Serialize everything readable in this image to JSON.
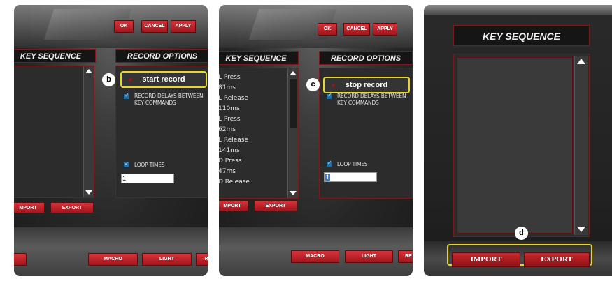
{
  "panel_b": {
    "buttons": {
      "ok": "OK",
      "cancel": "CANCEL",
      "apply": "APPLY"
    },
    "key_sequence_title": "KEY SEQUENCE",
    "record_options_title": "RECORD OPTIONS",
    "callout": "b",
    "record_button": "start record",
    "record_delays_label": "RECORD DELAYS BETWEEN KEY COMMANDS",
    "loop_times_label": "LOOP TIMES",
    "loop_times_value": "1",
    "import_label": "MPORT",
    "export_label": "EXPORT",
    "macro_label": "MACRO",
    "light_label": "LIGHT",
    "partial_label": "R"
  },
  "panel_c": {
    "buttons": {
      "ok": "OK",
      "cancel": "CANCEL",
      "apply": "APPLY"
    },
    "key_sequence_title": "KEY SEQUENCE",
    "record_options_title": "RECORD OPTIONS",
    "callout": "c",
    "record_button": "stop record",
    "record_delays_label": "RECORD DELAYS BETWEEN KEY COMMANDS",
    "loop_times_label": "LOOP TIMES",
    "loop_times_value": "1",
    "sequence_items": [
      "L Press",
      "81ms",
      "L Release",
      "110ms",
      "L Press",
      "62ms",
      "L Release",
      "141ms",
      "D Press",
      "47ms",
      "D Release"
    ],
    "import_label": "MPORT",
    "export_label": "EXPORT",
    "macro_label": "MACRO",
    "light_label": "LIGHT",
    "partial_label": "RE"
  },
  "panel_d": {
    "key_sequence_title": "KEY SEQUENCE",
    "callout": "d",
    "import_label": "IMPORT",
    "export_label": "EXPORT"
  },
  "colors": {
    "accent_red": "#c9262d",
    "highlight_yellow": "#e7d52c",
    "checkbox_blue": "#1e6fa8"
  }
}
